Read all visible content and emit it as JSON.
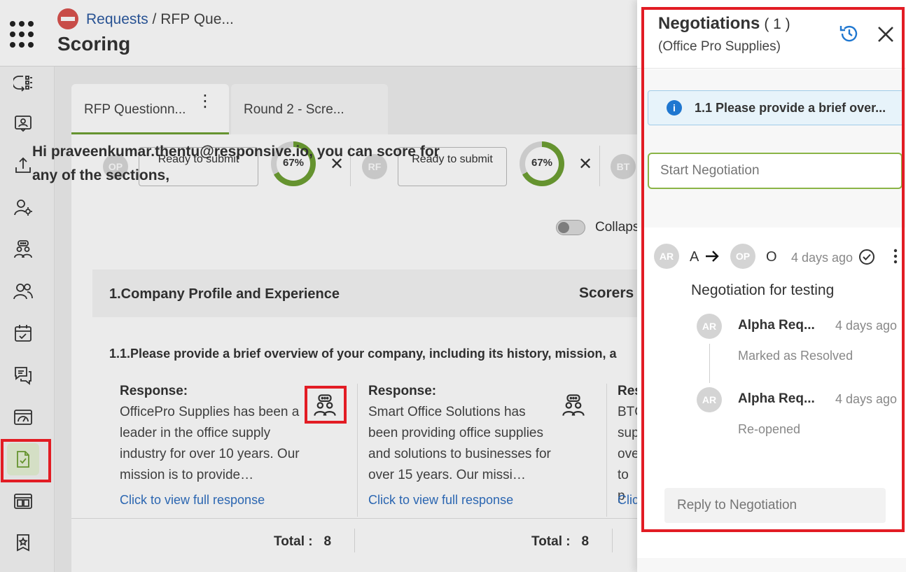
{
  "header": {
    "breadcrumb_link": "Requests",
    "breadcrumb_sep": " / ",
    "breadcrumb_current": "RFP Que...",
    "title": "Scoring"
  },
  "tabs": [
    {
      "label": "RFP Questionn..."
    },
    {
      "label": "Round 2 - Scre..."
    }
  ],
  "vendors": [
    {
      "initials": "OP",
      "status": "Ready to submit",
      "progress_label": "67%",
      "progress": 0.67
    },
    {
      "initials": "RF",
      "status": "Ready to submit",
      "progress_label": "67%",
      "progress": 0.67
    },
    {
      "initials": "BT"
    }
  ],
  "close_symbol": "✕",
  "greeting": "Hi praveenkumar.thentu@responsive.io, you can score for any of the sections,",
  "collapse_label": "Collaps",
  "section": {
    "title": "1.Company Profile and Experience",
    "scorers_label": "Scorers"
  },
  "question": "1.1.Please provide a brief overview of your company, including its history, mission, a",
  "responses": [
    {
      "label": "Response:",
      "text": "OfficePro Supplies has been a leader in the office supply industry for over 10 years. Our mission is to provide…",
      "link": "Click to view full response"
    },
    {
      "label": "Response:",
      "text": "Smart Office Solutions has been providing office supplies and solutions to businesses for over 15 years. Our missi…",
      "link": "Click to view full response"
    },
    {
      "label": "Res",
      "text": "BTC sup ove to p",
      "link": "Clic"
    }
  ],
  "totals": [
    {
      "label": "Total :",
      "value": "8"
    },
    {
      "label": "Total :",
      "value": "8"
    }
  ],
  "panel": {
    "title": "Negotiations",
    "count": "( 1 )",
    "subtitle": "(Office Pro Supplies)",
    "question_ref": "1.1 Please provide a brief over...",
    "start_placeholder": "Start Negotiation",
    "thread": {
      "from_initials": "AR",
      "from_letter": "A",
      "to_initials": "OP",
      "to_letter": "O",
      "time": "4 days ago",
      "message": "Negotiation for testing",
      "events": [
        {
          "initials": "AR",
          "name": "Alpha Req...",
          "time": "4 days ago",
          "event": "Marked as Resolved"
        },
        {
          "initials": "AR",
          "name": "Alpha Req...",
          "time": "4 days ago",
          "event": "Re-opened"
        }
      ]
    },
    "reply_placeholder": "Reply to Negotiation"
  },
  "colors": {
    "accent_green": "#6ea033",
    "link_blue": "#2f6fc1",
    "highlight_red": "#e21c24",
    "info_blue": "#1f77d0"
  },
  "icons": {
    "sidebar": [
      "task-flow-icon",
      "contact-card-icon",
      "upload-icon",
      "user-settings-icon",
      "negotiation-icon",
      "users-icon",
      "calendar-check-icon",
      "chat-icon",
      "dashboard-icon",
      "scoring-doc-icon",
      "layout-icon",
      "award-icon"
    ]
  }
}
